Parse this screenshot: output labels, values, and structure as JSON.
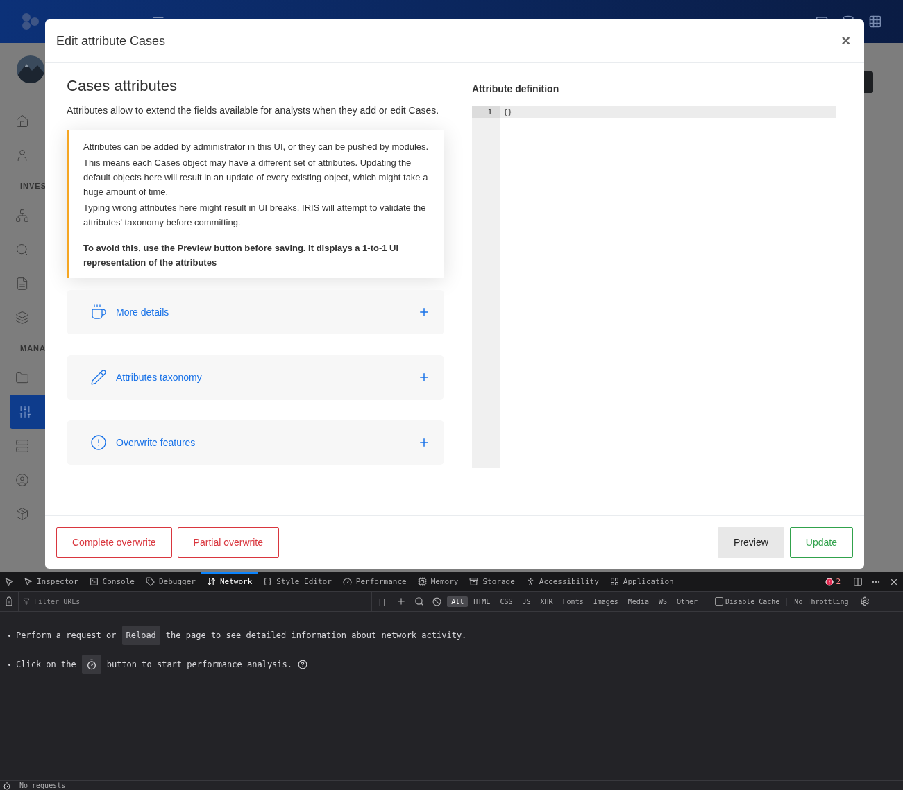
{
  "app": {
    "sidebar_sections": [
      "INVES",
      "MANA"
    ]
  },
  "modal": {
    "title": "Edit attribute Cases",
    "close": "×",
    "heading": "Cases attributes",
    "description": "Attributes allow to extend the fields available for analysts when they add or edit Cases.",
    "notice": [
      "Attributes can be added by administrator in this UI, or they can be pushed by modules.",
      "This means each Cases object may have a different set of attributes. Updating the default objects here will result in an update of every existing object, which might take a huge amount of time.",
      "Typing wrong attributes here might result in UI breaks. IRIS will attempt to validate the attributes' taxonomy before committing."
    ],
    "notice_bold": "To avoid this, use the Preview button before saving. It displays a 1-to-1 UI representation of the attributes",
    "sections": [
      {
        "kind": "cup",
        "label": "More details",
        "expanded": false
      },
      {
        "kind": "pencil",
        "label": "Attributes taxonomy",
        "expanded": false
      },
      {
        "kind": "alert",
        "label": "Overwrite features",
        "expanded": false
      }
    ],
    "editor_label": "Attribute definition",
    "editor_lines": [
      {
        "number": "1",
        "text": "{}"
      }
    ],
    "footer_left": [
      "Complete overwrite",
      "Partial overwrite"
    ],
    "footer_right": [
      {
        "kind": "secondary",
        "label": "Preview"
      },
      {
        "kind": "success",
        "label": "Update"
      }
    ]
  },
  "devtools": {
    "tabs": [
      {
        "label": "Inspector",
        "selected": false
      },
      {
        "label": "Console",
        "selected": false
      },
      {
        "label": "Debugger",
        "selected": false
      },
      {
        "label": "Network",
        "selected": true
      },
      {
        "label": "Style Editor",
        "selected": false
      },
      {
        "label": "Performance",
        "selected": false
      },
      {
        "label": "Memory",
        "selected": false
      },
      {
        "label": "Storage",
        "selected": false
      },
      {
        "label": "Accessibility",
        "selected": false
      },
      {
        "label": "Application",
        "selected": false
      }
    ],
    "error_count": "2",
    "filter_placeholder": "Filter URLs",
    "pause": "||",
    "type_filters": [
      {
        "label": "All",
        "selected": true
      },
      {
        "label": "HTML",
        "selected": false
      },
      {
        "label": "CSS",
        "selected": false
      },
      {
        "label": "JS",
        "selected": false
      },
      {
        "label": "XHR",
        "selected": false
      },
      {
        "label": "Fonts",
        "selected": false
      },
      {
        "label": "Images",
        "selected": false
      },
      {
        "label": "Media",
        "selected": false
      },
      {
        "label": "WS",
        "selected": false
      },
      {
        "label": "Other",
        "selected": false
      }
    ],
    "disable_cache": {
      "label": "Disable Cache",
      "checked": false
    },
    "throttling": "No Throttling",
    "message_1": {
      "before": "Perform a request or",
      "button": "Reload",
      "after": "the page to see detailed information about network activity."
    },
    "message_2": {
      "before": "Click on the",
      "after": "button to start performance analysis."
    },
    "status": "No requests"
  }
}
